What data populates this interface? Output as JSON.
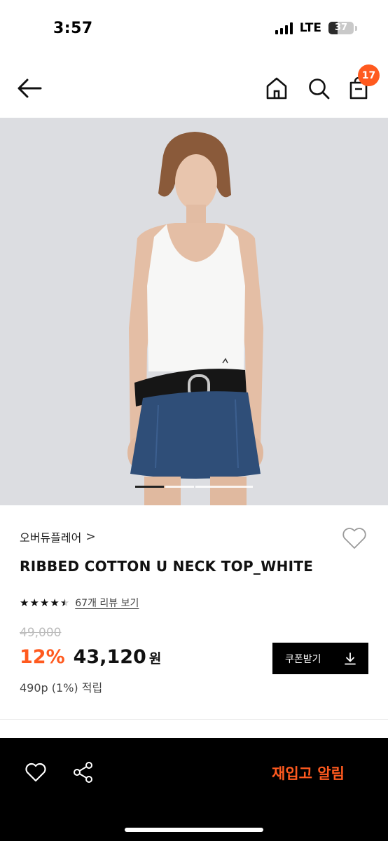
{
  "status_bar": {
    "time": "3:57",
    "network": "LTE",
    "battery": "37"
  },
  "header": {
    "back_icon": "arrow-left-icon",
    "home_icon": "home-icon",
    "search_icon": "search-icon",
    "bag_icon": "shopping-bag-icon",
    "cart_count": "17"
  },
  "gallery": {
    "image": "model wearing white ribbed tank top, black belt and denim mini skirt",
    "slide_count": 3,
    "active_slide": 1
  },
  "product": {
    "brand": "오버듀플레어",
    "brand_chevron": ">",
    "name": "RIBBED COTTON U NECK TOP_WHITE",
    "rating": 4.5,
    "review_link": "67개 리뷰 보기",
    "original_price": "49,000",
    "discount": "12%",
    "price": "43,120",
    "currency": "원",
    "points": "490p (1%) 적립"
  },
  "coupon": {
    "label": "쿠폰받기",
    "icon": "download-icon"
  },
  "bottom_bar": {
    "wishlist_icon": "heart-outline-icon",
    "share_icon": "share-icon",
    "restock_label": "재입고 알림"
  },
  "colors": {
    "accent": "#ff5a1f",
    "bar_bg": "#000000"
  }
}
